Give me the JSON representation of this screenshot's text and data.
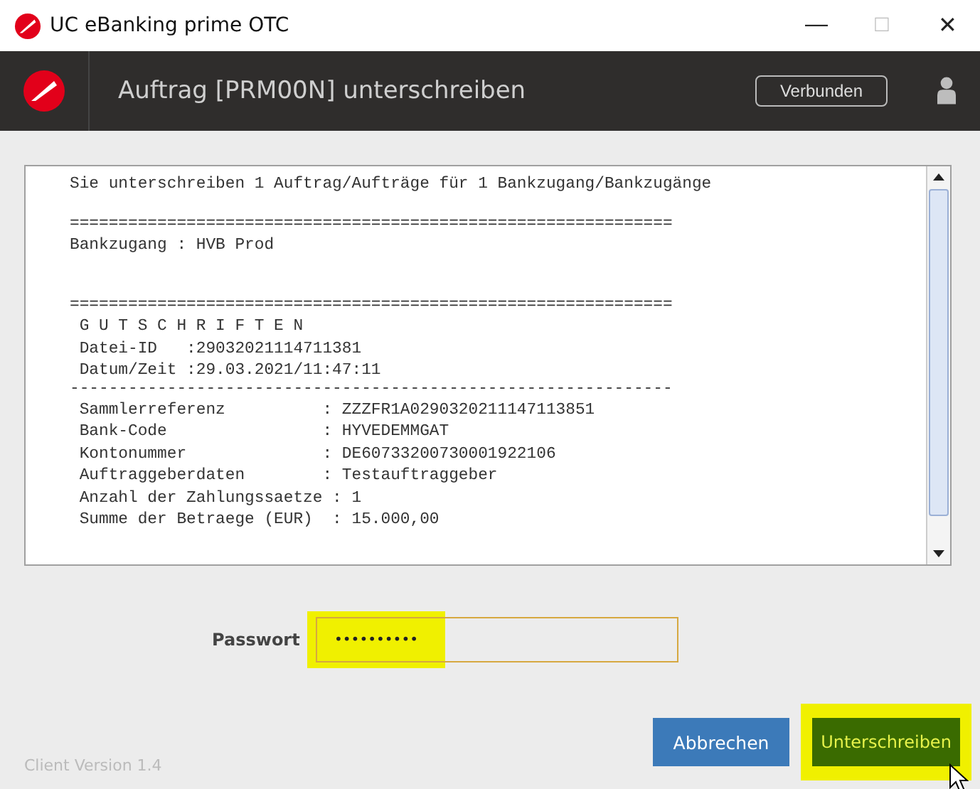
{
  "window": {
    "title": "UC eBanking prime OTC",
    "controls": [
      "—",
      "□",
      "✕"
    ]
  },
  "header": {
    "title": "Auftrag [PRM00N] unterschreiben",
    "status_button": "Verbunden"
  },
  "document": {
    "lines": [
      {
        "kind": "text",
        "text": "Sie unterschreiben 1 Auftrag/Aufträge für 1 Bankzugang/Bankzugänge"
      },
      {
        "kind": "blank"
      },
      {
        "kind": "rule",
        "text": "=============================================================="
      },
      {
        "kind": "text",
        "text": "Bankzugang : HVB Prod"
      },
      {
        "kind": "blank"
      },
      {
        "kind": "blank"
      },
      {
        "kind": "rule",
        "text": "=============================================================="
      },
      {
        "kind": "text",
        "text": " G U T S C H R I F T E N"
      },
      {
        "kind": "text",
        "text": " Datei-ID   :29032021114711381"
      },
      {
        "kind": "text",
        "text": " Datum/Zeit :29.03.2021/11:47:11"
      },
      {
        "kind": "rule",
        "text": "--------------------------------------------------------------"
      },
      {
        "kind": "text",
        "text": " Sammlerreferenz          : ZZZFR1A0290320211147113851"
      },
      {
        "kind": "text",
        "text": " Bank-Code                : HYVEDEMMGAT"
      },
      {
        "kind": "text",
        "text": " Kontonummer              : DE60733200730001922106"
      },
      {
        "kind": "text",
        "text": " Auftraggeberdaten        : Testauftraggeber"
      },
      {
        "kind": "text",
        "text": " Anzahl der Zahlungssaetze : 1"
      },
      {
        "kind": "text",
        "text": " Summe der Betraege (EUR)  : 15.000,00"
      }
    ]
  },
  "password": {
    "label": "Passwort",
    "value": "••••••••••",
    "highlighted": true
  },
  "footer": {
    "version": "Client Version 1.4"
  },
  "buttons": [
    {
      "kind": "cancel",
      "label": "Abbrechen",
      "highlighted": false
    },
    {
      "kind": "confirm",
      "label": "Unterschreiben",
      "highlighted": true
    }
  ]
}
